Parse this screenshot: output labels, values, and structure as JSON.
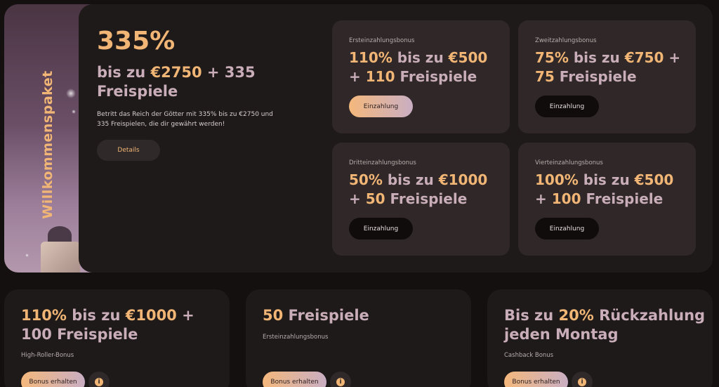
{
  "welcome": {
    "side_title": "Willkommenspaket",
    "percent": "335%",
    "subtitle_pre": "bis zu ",
    "subtitle_amount": "€2750",
    "subtitle_post": " + 335 Freispiele",
    "description": "Betritt das Reich der Götter mit 335% bis zu €2750 und 335 Freispielen, die dir gewährt werden!",
    "details_label": "Details"
  },
  "bonus_cards": [
    {
      "label": "Ersteinzahlungsbonus",
      "pct": "110%",
      "mid": " bis zu ",
      "amount": "€500",
      "plus": " + ",
      "spins_num": "110",
      "spins_word": " Freispiele",
      "button": "Einzahlung"
    },
    {
      "label": "Zweitzahlungsbonus",
      "pct": "75%",
      "mid": " bis zu ",
      "amount": "€750",
      "plus": " + ",
      "spins_num": "75",
      "spins_word": " Freispiele",
      "button": "Einzahlung"
    },
    {
      "label": "Dritteinzahlungsbonus",
      "pct": "50%",
      "mid": " bis zu ",
      "amount": "€1000",
      "plus": " + ",
      "spins_num": "50",
      "spins_word": " Freispiele",
      "button": "Einzahlung"
    },
    {
      "label": "Vierteinzahlungsbonus",
      "pct": "100%",
      "mid": " bis zu ",
      "amount": "€500",
      "plus": " + ",
      "spins_num": "100",
      "spins_word": " Freispiele",
      "button": "Einzahlung"
    }
  ],
  "promos": [
    {
      "title_hl1": "110%",
      "title_mid": " bis zu ",
      "title_hl2": "€1000",
      "title_rest": " + 100 Freispiele",
      "label": "High-Roller-Bonus",
      "button": "Bonus erhalten",
      "info_icon": "i"
    },
    {
      "title_hl1": "50",
      "title_mid": " Freispiele",
      "title_hl2": "",
      "title_rest": "",
      "label": "Ersteinzahlungsbonus",
      "button": "Bonus erhalten",
      "info_icon": "i"
    },
    {
      "title_hl1": "",
      "title_mid": "Bis zu ",
      "title_hl2": "20%",
      "title_rest": " Rückzahlung jeden Montag",
      "label": "Cashback Bonus",
      "button": "Bonus erhalten",
      "info_icon": "i"
    }
  ],
  "colors": {
    "accent": "#f1b675",
    "secondary": "#c9aeba",
    "card": "#302828",
    "panel": "#1f1a1a",
    "background": "#141010"
  }
}
